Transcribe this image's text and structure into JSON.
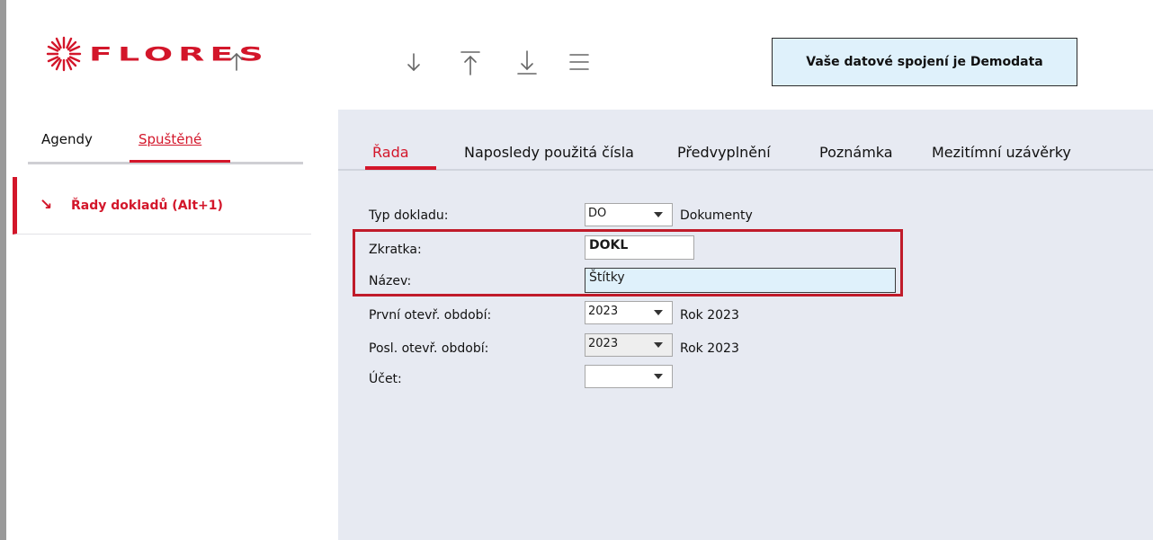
{
  "header": {
    "brand": "FLORES",
    "connection": "Vaše datové spojení je Demodata",
    "toolbar_icons": [
      "arrow-up-icon",
      "arrow-down-icon",
      "move-to-top-icon",
      "move-to-bottom-icon",
      "menu-icon"
    ]
  },
  "sidebar": {
    "tabs": [
      "Agendy",
      "Spuštěné"
    ],
    "active_tab": "Spuštěné",
    "items": [
      {
        "label": "Řady dokladů (Alt+1)"
      }
    ]
  },
  "main": {
    "tabs": [
      "Řada",
      "Naposledy použitá čísla",
      "Předvyplnění",
      "Poznámka",
      "Mezitímní uzávěrky"
    ],
    "active_tab": "Řada",
    "form": {
      "typ_dokladu": {
        "label": "Typ dokladu:",
        "value": "DO",
        "description": "Dokumenty"
      },
      "zkratka": {
        "label": "Zkratka:",
        "value": "DOKL"
      },
      "nazev": {
        "label": "Název:",
        "value": "Štítky"
      },
      "prvni_obdobi": {
        "label": "První otevř. období:",
        "value": "2023",
        "description": "Rok 2023"
      },
      "posl_obdobi": {
        "label": "Posl. otevř. období:",
        "value": "2023",
        "description": "Rok 2023"
      },
      "ucet": {
        "label": "Účet:",
        "value": ""
      }
    }
  },
  "colors": {
    "brand_red": "#d3162a",
    "highlight_red": "#c01b2a",
    "connection_bg": "#dff1fb",
    "main_bg": "#e7eaf2"
  }
}
